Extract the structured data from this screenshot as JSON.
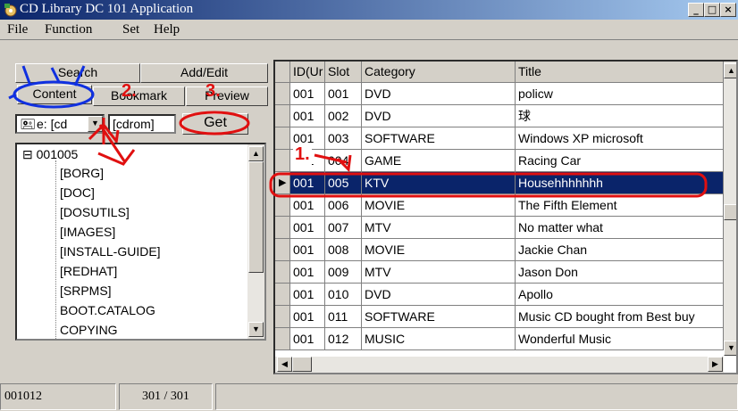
{
  "window": {
    "title": "CD Library DC 101 Application",
    "min": "_",
    "max": "□",
    "close": "×"
  },
  "menu": [
    "File",
    "Function",
    "Set",
    "Help"
  ],
  "tabs": {
    "search": "Search",
    "add_edit": "Add/Edit",
    "content": "Content",
    "bookmark": "Bookmark",
    "preview": "Preview"
  },
  "drive": {
    "selected": "e: [cd",
    "label": "[cdrom]",
    "get": "Get"
  },
  "tree": {
    "root": "001005",
    "root_toggle": "⊟",
    "children": [
      "[BORG]",
      "[DOC]",
      "[DOSUTILS]",
      "[IMAGES]",
      "[INSTALL-GUIDE]",
      "[REDHAT]",
      "[SRPMS]",
      "BOOT.CATALOG",
      "COPYING"
    ]
  },
  "grid": {
    "columns": [
      "ID(Ur",
      "Slot",
      "Category",
      "Title"
    ],
    "rows": [
      [
        "001",
        "001",
        "DVD",
        "policw"
      ],
      [
        "001",
        "002",
        "DVD",
        "球"
      ],
      [
        "001",
        "003",
        "SOFTWARE",
        "Windows XP microsoft"
      ],
      [
        "001",
        "004",
        "GAME",
        "Racing Car"
      ],
      [
        "001",
        "005",
        "KTV",
        "Househhhhhhh"
      ],
      [
        "001",
        "006",
        "MOVIE",
        "The Fifth Element"
      ],
      [
        "001",
        "007",
        "MTV",
        "No matter what"
      ],
      [
        "001",
        "008",
        "MOVIE",
        "Jackie Chan"
      ],
      [
        "001",
        "009",
        "MTV",
        "Jason Don"
      ],
      [
        "001",
        "010",
        "DVD",
        "Apollo"
      ],
      [
        "001",
        "011",
        "SOFTWARE",
        "Music CD bought from Best buy"
      ],
      [
        "001",
        "012",
        "MUSIC",
        "Wonderful Music"
      ]
    ],
    "selected_row": 4
  },
  "status": {
    "current": "001012",
    "count": "301 / 301"
  },
  "annotations": {
    "step1": "1.",
    "step2": "2.",
    "step3": "3."
  },
  "colors": {
    "selection": "#0a246a",
    "annotation_red": "#e01010",
    "annotation_blue": "#1030e0"
  }
}
